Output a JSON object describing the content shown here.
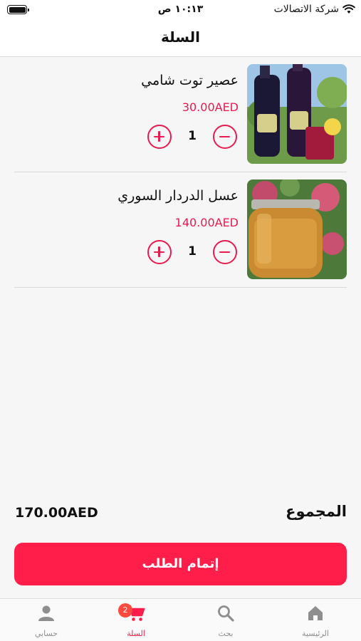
{
  "status_bar": {
    "carrier": "شركة الاتصالات",
    "time": "١٠:١٣ ص"
  },
  "header": {
    "title": "السلة"
  },
  "cart": {
    "items": [
      {
        "name": "عصير توت شامي",
        "price": "30.00AED",
        "quantity": "1",
        "image": "berry-juice-bottles-photo"
      },
      {
        "name": "عسل الدردار السوري",
        "price": "140.00AED",
        "quantity": "1",
        "image": "honey-jar-photo"
      }
    ]
  },
  "summary": {
    "total_label": "المجموع",
    "total_value": "170.00AED"
  },
  "checkout": {
    "label": "إتمام الطلب"
  },
  "tab_bar": {
    "items": [
      {
        "label": "الرئيسية",
        "icon": "home-icon",
        "active": false
      },
      {
        "label": "بحث",
        "icon": "search-icon",
        "active": false
      },
      {
        "label": "السلة",
        "icon": "cart-icon",
        "active": true,
        "badge": "2"
      },
      {
        "label": "حسابي",
        "icon": "person-icon",
        "active": false
      }
    ]
  },
  "colors": {
    "accent": "#ff1e4a",
    "price": "#e81b4f",
    "tab_inactive": "#8e8e8e",
    "badge": "#ff4a3f"
  }
}
